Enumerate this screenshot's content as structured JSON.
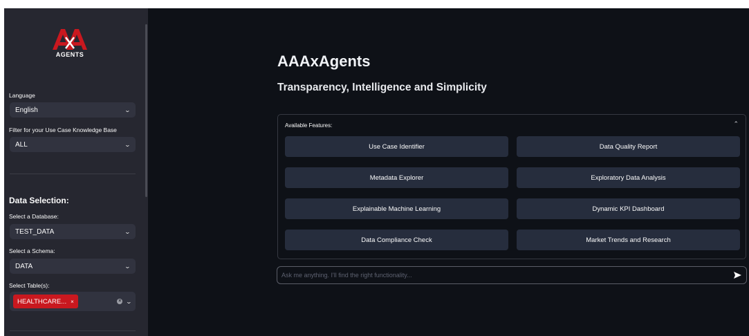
{
  "sidebar": {
    "logo_word": "AGENTS",
    "language_label": "Language",
    "language_value": "English",
    "filter_label": "Filter for your Use Case Knowledge Base",
    "filter_value": "ALL",
    "data_selection_heading": "Data Selection:",
    "database_label": "Select a Database:",
    "database_value": "TEST_DATA",
    "schema_label": "Select a Schema:",
    "schema_value": "DATA",
    "tables_label": "Select Table(s):",
    "table_tag": "HEALTHCARE...",
    "tag_remove": "×",
    "clear_icon": "×",
    "chevron": "⌄"
  },
  "main": {
    "title": "AAAxAgents",
    "subtitle": "Transparency, Intelligence and Simplicity",
    "features_label": "Available Features:",
    "collapse_glyph": "⌃",
    "features": [
      "Use Case Identifier",
      "Data Quality Report",
      "Metadata Explorer",
      "Exploratory Data Analysis",
      "Explainable Machine Learning",
      "Dynamic KPI Dashboard",
      "Data Compliance Check",
      "Market Trends and Research"
    ],
    "chat_placeholder": "Ask me anything. I'll find the right functionality..."
  },
  "colors": {
    "background": "#0e1117",
    "sidebar": "#262730",
    "select": "#31333f",
    "feature_button": "#262d3d",
    "accent_red": "#c9181f"
  },
  "icons": [
    "logo-icon",
    "chevron-down-icon",
    "clear-icon",
    "chevron-up-icon",
    "send-icon"
  ]
}
